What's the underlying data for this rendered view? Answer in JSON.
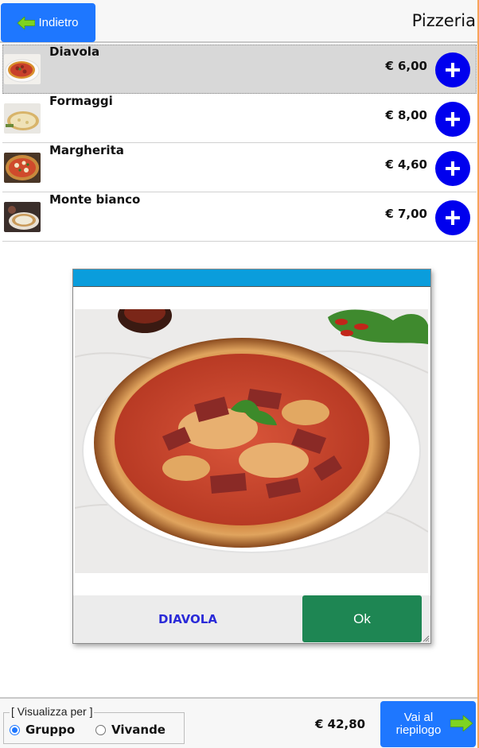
{
  "header": {
    "back_label": "Indietro",
    "title": "Pizzeria"
  },
  "products": [
    {
      "name": "Diavola",
      "price": "€ 6,00",
      "selected": true
    },
    {
      "name": "Formaggi",
      "price": "€ 8,00",
      "selected": false
    },
    {
      "name": "Margherita",
      "price": "€ 4,60",
      "selected": false
    },
    {
      "name": "Monte bianco",
      "price": "€ 7,00",
      "selected": false
    }
  ],
  "modal": {
    "caption": "DIAVOLA",
    "ok_label": "Ok"
  },
  "footer": {
    "view_legend": "[ Visualizza per ]",
    "options": [
      {
        "label": "Gruppo",
        "checked": true
      },
      {
        "label": "Vivande",
        "checked": false
      }
    ],
    "total": "€ 42,80",
    "next_label": "Vai al riepilogo"
  },
  "colors": {
    "primary_blue": "#1e77ff",
    "add_button": "#0000ee",
    "modal_titlebar": "#0a9ddc",
    "ok_button": "#1e8653",
    "caption_text": "#2a2ad8"
  },
  "icons": {
    "back": "arrow-left-icon",
    "add": "plus-icon",
    "next": "arrow-right-icon"
  }
}
